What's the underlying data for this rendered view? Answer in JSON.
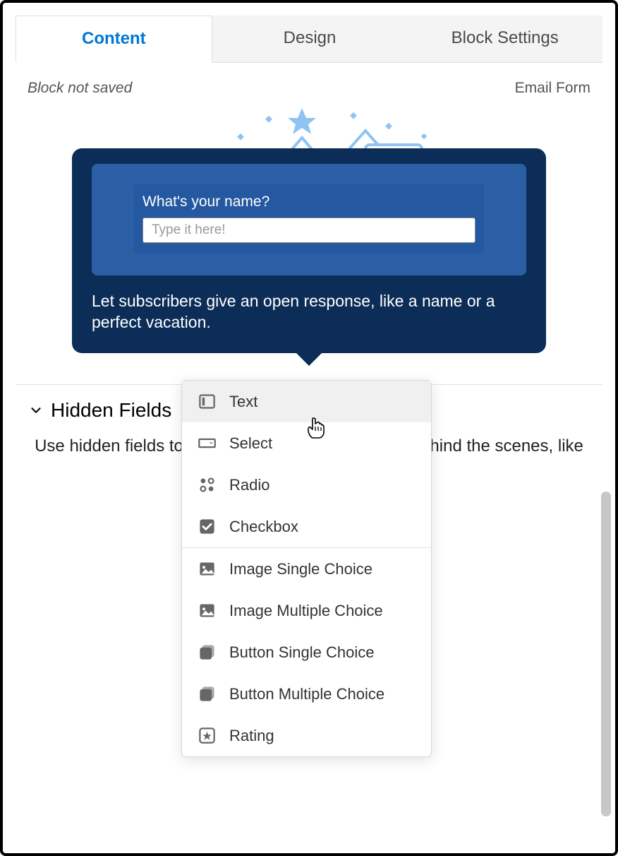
{
  "tabs": {
    "content": "Content",
    "design": "Design",
    "block_settings": "Block Settings"
  },
  "status": {
    "not_saved": "Block not saved",
    "block_type": "Email Form"
  },
  "tooltip": {
    "question": "What's your name?",
    "placeholder": "Type it here!",
    "description": "Let subscribers give an open response, like a name or a perfect vacation."
  },
  "hidden_fields": {
    "title": "Hidden Fields",
    "description": "Use hidden fields to submit info you already know behind the scenes, like subscriber or product ID."
  },
  "dropdown": {
    "text": "Text",
    "select": "Select",
    "radio": "Radio",
    "checkbox": "Checkbox",
    "image_single": "Image Single Choice",
    "image_multiple": "Image Multiple Choice",
    "button_single": "Button Single Choice",
    "button_multiple": "Button Multiple Choice",
    "rating": "Rating"
  }
}
